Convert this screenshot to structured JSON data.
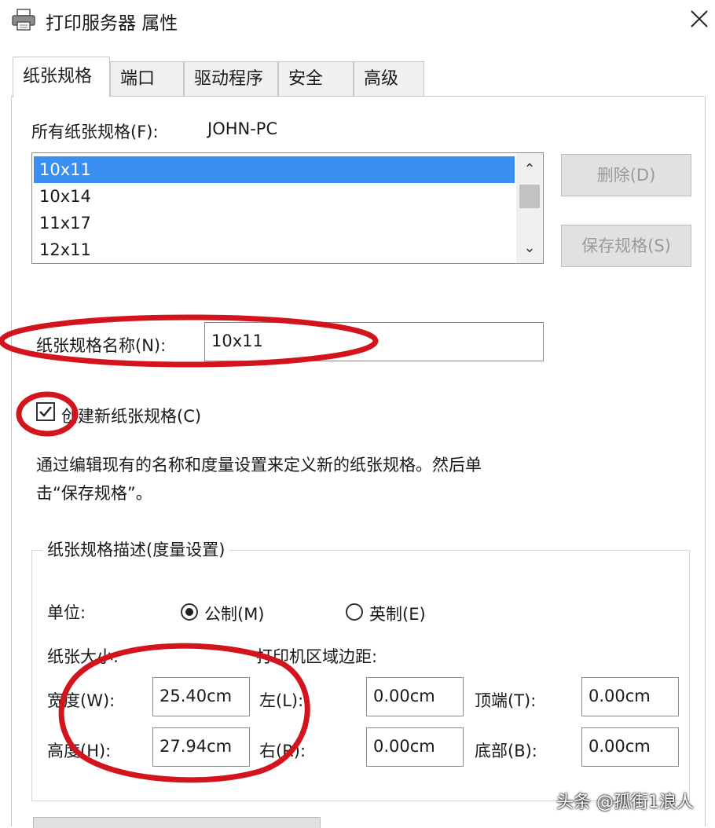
{
  "window": {
    "title": "打印服务器 属性",
    "close_icon": "close-icon",
    "app_icon": "printer-icon"
  },
  "tabs": [
    {
      "label": "纸张规格",
      "active": true
    },
    {
      "label": "端口"
    },
    {
      "label": "驱动程序"
    },
    {
      "label": "安全"
    },
    {
      "label": "高级"
    }
  ],
  "forms": {
    "all_forms_label": "所有纸张规格(F):",
    "server_name": "JOHN-PC",
    "list": [
      "10x11",
      "10x14",
      "11x17",
      "12x11"
    ],
    "selected": "10x11",
    "delete_button": "删除(D)",
    "save_button": "保存规格(S)",
    "form_name_label": "纸张规格名称(N):",
    "form_name_value": "10x11",
    "create_new_label": "创建新纸张规格(C)",
    "create_new_checked": true,
    "description_line1": "通过编辑现有的名称和度量设置来定义新的纸张规格。然后单",
    "description_line2": "击“保存规格”。"
  },
  "measurements": {
    "group_title": "纸张规格描述(度量设置)",
    "unit_label": "单位:",
    "unit_metric": "公制(M)",
    "unit_english": "英制(E)",
    "unit_selected": "metric",
    "paper_size_label": "纸张大小:",
    "printer_margins_label": "打印机区域边距:",
    "width_label": "宽度(W):",
    "width_value": "25.40cm",
    "height_label": "高度(H):",
    "height_value": "27.94cm",
    "left_label": "左(L):",
    "left_value": "0.00cm",
    "right_label": "右(R):",
    "right_value": "0.00cm",
    "top_label": "顶端(T):",
    "top_value": "0.00cm",
    "bottom_label": "底部(B):",
    "bottom_value": "0.00cm"
  },
  "annotation_color": "#d4141c",
  "selection_color": "#3b8ff0",
  "watermark": "头条 @孤街1浪人"
}
